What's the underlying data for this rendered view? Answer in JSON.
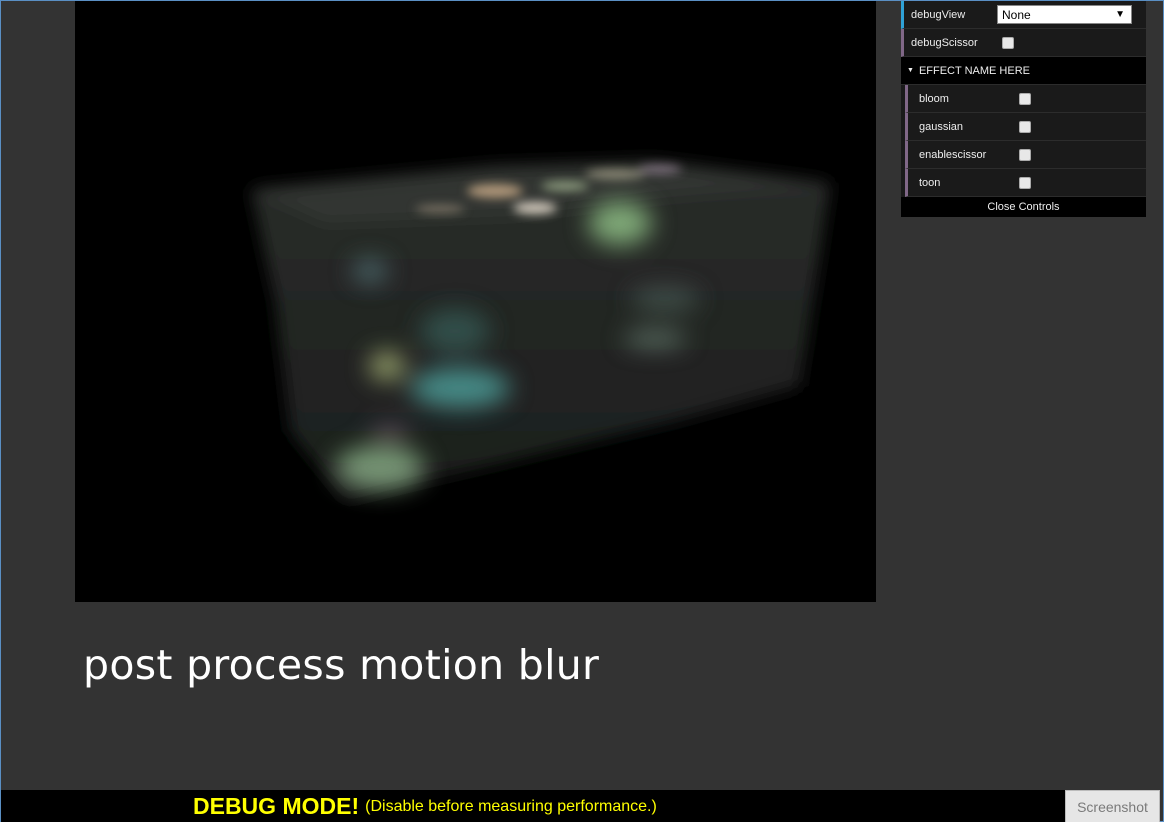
{
  "gui": {
    "debug_view_label": "debugView",
    "debug_view_value": "None",
    "debug_scissor_label": "debugScissor",
    "folder_title": "EFFECT NAME HERE",
    "effects": [
      {
        "label": "bloom",
        "checked": false
      },
      {
        "label": "gaussian",
        "checked": false
      },
      {
        "label": "enablescissor",
        "checked": false
      },
      {
        "label": "toon",
        "checked": false
      }
    ],
    "close_label": "Close Controls"
  },
  "caption": "post process motion blur",
  "debug_bar": {
    "title": "DEBUG MODE!",
    "note": "(Disable before measuring performance.)"
  },
  "screenshot_label": "Screenshot",
  "colors": {
    "background": "#333333",
    "accent_blue": "#2fa1d6",
    "accent_purple": "#806787",
    "debug_text": "#ffff00"
  }
}
